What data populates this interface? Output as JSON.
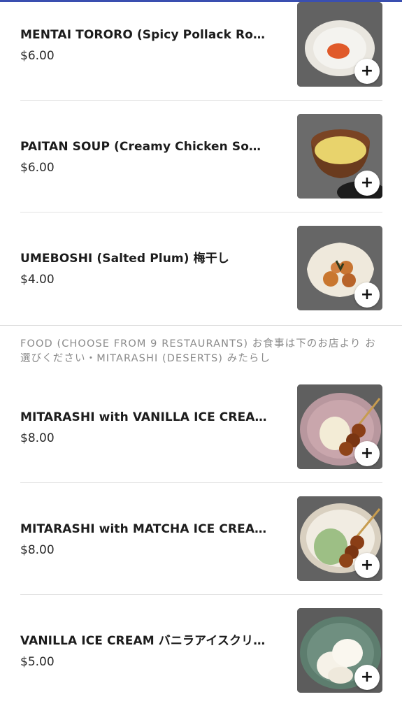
{
  "items_top": [
    {
      "name": "MENTAI TORORO (Spicy Pollack Roe wit…",
      "price": "$6.00",
      "add_label": "+"
    },
    {
      "name": "PAITAN SOUP (Creamy Chicken Soup) …",
      "price": "$6.00",
      "add_label": "+"
    },
    {
      "name": "UMEBOSHI (Salted Plum) 梅干し",
      "price": "$4.00",
      "add_label": "+"
    }
  ],
  "section": {
    "title": "FOOD (CHOOSE FROM 9 RESTAURANTS) お食事は下のお店より お選びください・MITARASHI (DESERTS) みたらし"
  },
  "items_bottom": [
    {
      "name": "MITARASHI with VANILLA ICE CREAM…",
      "price": "$8.00",
      "add_label": "+"
    },
    {
      "name": "MITARASHI with MATCHA ICE CREAM…",
      "price": "$8.00",
      "add_label": "+"
    },
    {
      "name": "VANILLA ICE CREAM バニラアイスクリ…",
      "price": "$5.00",
      "add_label": "+"
    }
  ],
  "colors": {
    "accent_bar": "#3a4fb0",
    "section_text": "#8a8a8a"
  }
}
